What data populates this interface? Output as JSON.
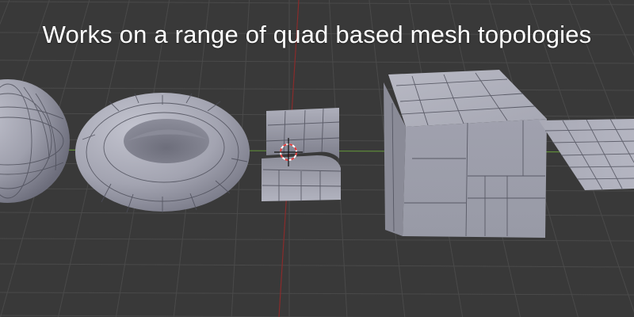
{
  "viewport": {
    "caption": "Works on a range of quad based mesh topologies"
  },
  "colors": {
    "background": "#393939",
    "grid": "#4a4a4a",
    "x_axis": "#5e8a3a",
    "y_axis": "#8a2b2b",
    "mesh_light": "#b7b8c4",
    "mesh_mid": "#9a9ba8",
    "mesh_dark": "#6f7080",
    "edge": "#2e2f36",
    "cursor_red": "#e23a3a"
  },
  "scene_objects": [
    {
      "name": "uv-sphere",
      "shape": "sphere"
    },
    {
      "name": "torus",
      "shape": "torus"
    },
    {
      "name": "curved-strip",
      "shape": "bent plane"
    },
    {
      "name": "cube",
      "shape": "cube"
    },
    {
      "name": "plane",
      "shape": "plane"
    }
  ],
  "cursor": {
    "name": "3d-cursor-icon"
  }
}
